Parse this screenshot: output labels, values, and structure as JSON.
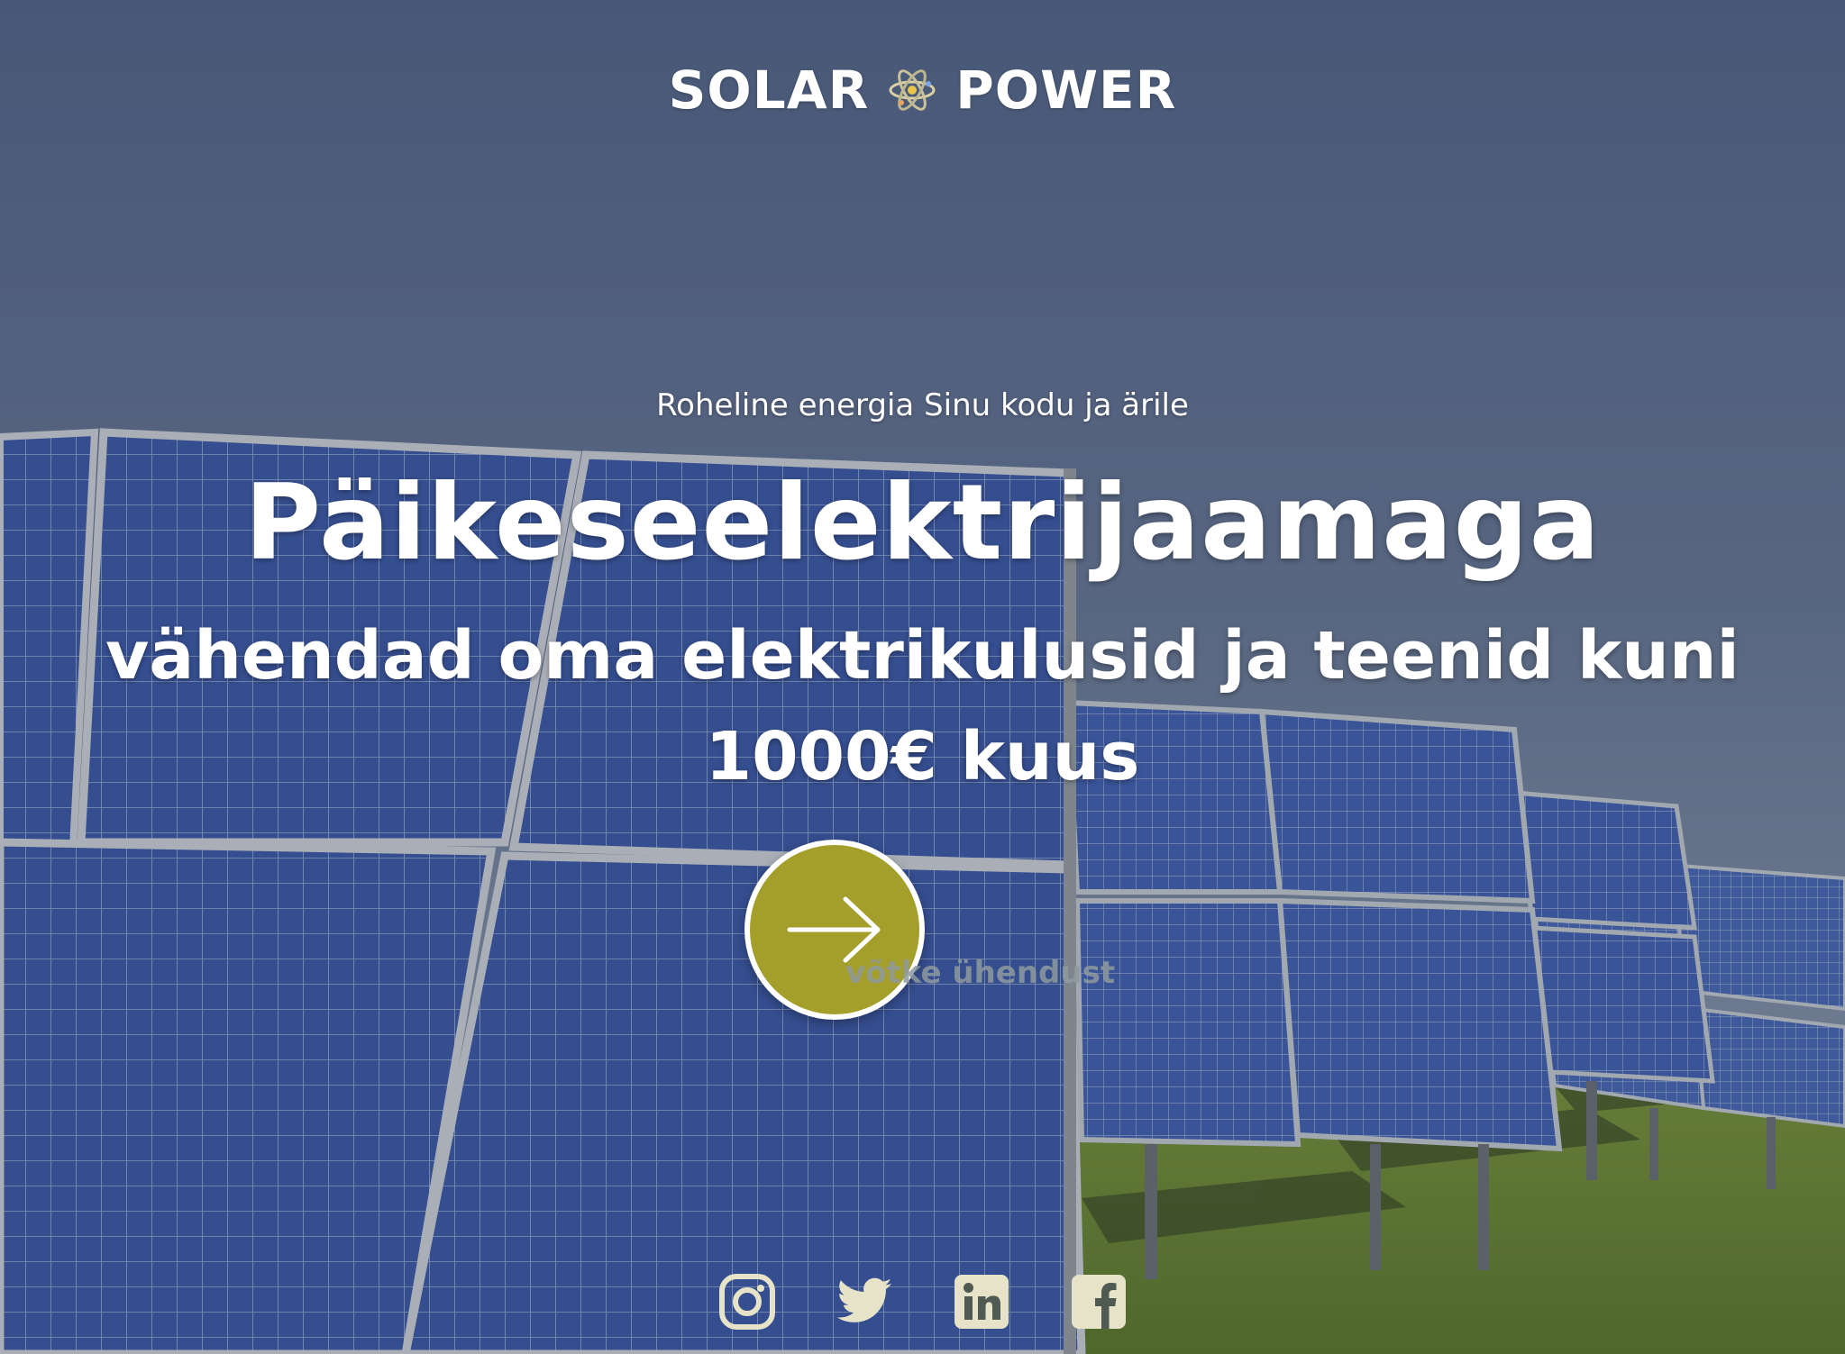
{
  "brand": {
    "left_word": "SOLAR",
    "right_word": "POWER",
    "logo_icon": "atom-icon"
  },
  "hero": {
    "tagline": "Roheline energia Sinu kodu ja ärile",
    "headline": "Päikeseelektrijaamaga",
    "subheadline": "vähendad oma elektrikulusid ja teenid kuni 1000€ kuus"
  },
  "cta": {
    "label": "võtke ühendust",
    "icon": "arrow-right-icon",
    "color": "#a49e2a"
  },
  "social": [
    {
      "name": "instagram",
      "icon": "instagram-icon"
    },
    {
      "name": "twitter",
      "icon": "twitter-icon"
    },
    {
      "name": "linkedin",
      "icon": "linkedin-icon"
    },
    {
      "name": "facebook",
      "icon": "facebook-icon"
    }
  ],
  "colors": {
    "icon_fill": "#e6e3c8",
    "sky_top": "#55668a",
    "panel_blue": "#3f5fb0"
  }
}
